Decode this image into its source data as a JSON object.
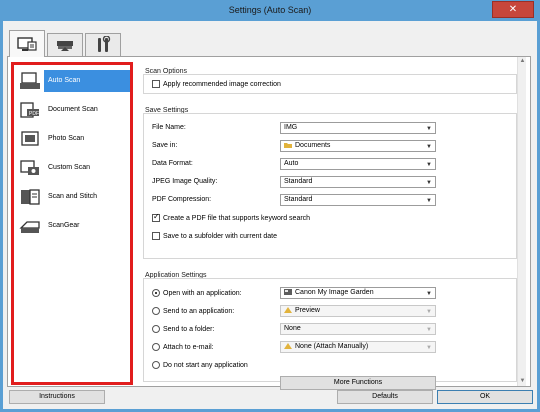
{
  "window": {
    "title": "Settings (Auto Scan)",
    "close_glyph": "✕"
  },
  "tabs": [
    {
      "name": "scan-from-computer-tab",
      "icon": "computer-scan-icon",
      "active": true
    },
    {
      "name": "scan-from-panel-tab",
      "icon": "scanner-panel-icon",
      "active": false
    },
    {
      "name": "general-settings-tab",
      "icon": "tools-icon",
      "active": false
    }
  ],
  "sidebar": {
    "items": [
      {
        "label": "Auto Scan",
        "icon": "auto-scan-icon",
        "selected": true
      },
      {
        "label": "Document Scan",
        "icon": "document-scan-icon",
        "selected": false
      },
      {
        "label": "Photo Scan",
        "icon": "photo-scan-icon",
        "selected": false
      },
      {
        "label": "Custom Scan",
        "icon": "custom-scan-icon",
        "selected": false
      },
      {
        "label": "Scan and Stitch",
        "icon": "scan-and-stitch-icon",
        "selected": false
      },
      {
        "label": "ScanGear",
        "icon": "scangear-icon",
        "selected": false
      }
    ],
    "highlight_color": "#e11d1d",
    "selected_color": "#3b8fe0"
  },
  "scan_options": {
    "title": "Scan Options",
    "apply_correction": {
      "label": "Apply recommended image correction",
      "checked": false
    }
  },
  "save_settings": {
    "title": "Save Settings",
    "file_name": {
      "label": "File Name:",
      "value": "IMG"
    },
    "save_in": {
      "label": "Save in:",
      "value": "Documents"
    },
    "data_format": {
      "label": "Data Format:",
      "value": "Auto"
    },
    "jpeg_quality": {
      "label": "JPEG Image Quality:",
      "value": "Standard"
    },
    "pdf_compression": {
      "label": "PDF Compression:",
      "value": "Standard"
    },
    "keyword_pdf": {
      "label": "Create a PDF file that supports keyword search",
      "checked": true
    },
    "subfolder": {
      "label": "Save to a subfolder with current date",
      "checked": false
    }
  },
  "app_settings": {
    "title": "Application Settings",
    "open_with_app": {
      "label": "Open with an application:",
      "value": "Canon My Image Garden",
      "selected": true
    },
    "send_to_app": {
      "label": "Send to an application:",
      "value": "Preview",
      "selected": false
    },
    "send_to_folder": {
      "label": "Send to a folder:",
      "value": "None",
      "selected": false
    },
    "attach_email": {
      "label": "Attach to e-mail:",
      "value": "None (Attach Manually)",
      "selected": false
    },
    "do_not_start": {
      "label": "Do not start any application",
      "selected": false
    },
    "more_functions": "More Functions"
  },
  "footer": {
    "instructions": "Instructions",
    "defaults": "Defaults",
    "ok": "OK"
  }
}
